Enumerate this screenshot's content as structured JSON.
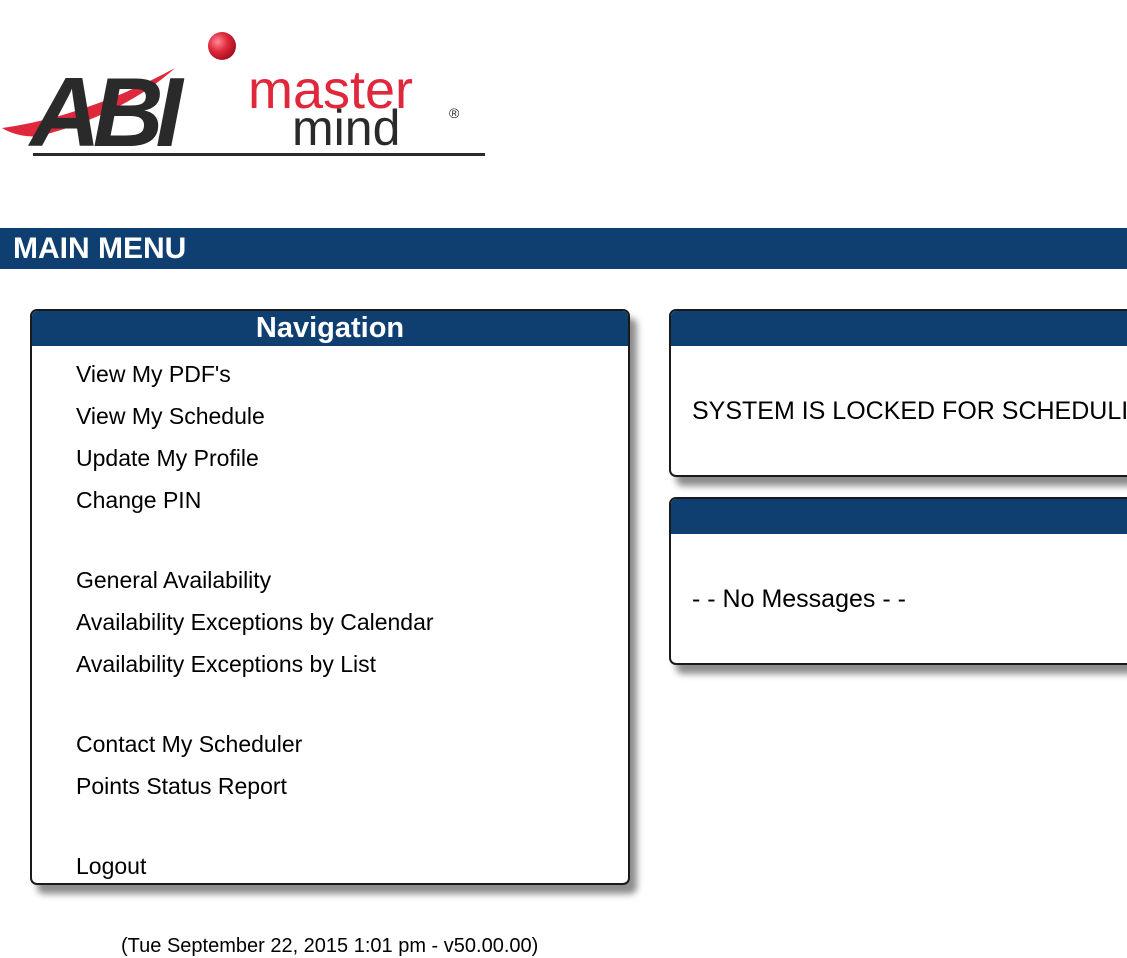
{
  "logo": {
    "brand": "ABI",
    "word1": "master",
    "word2": "mind",
    "registered": "®",
    "colors": {
      "dark": "#2a2a2a",
      "accent": "#e0283c"
    }
  },
  "menu_bar": {
    "title": "MAIN MENU",
    "color": "#0f3f70"
  },
  "navigation": {
    "title": "Navigation",
    "groups": [
      [
        "View My PDF's",
        "View My Schedule",
        "Update My Profile",
        "Change PIN"
      ],
      [
        "General Availability",
        "Availability Exceptions by Calendar",
        "Availability Exceptions by List"
      ],
      [
        "Contact My Scheduler",
        "Points Status Report"
      ],
      [
        "Logout"
      ]
    ]
  },
  "status_panel": {
    "title": "",
    "text": "SYSTEM IS LOCKED FOR SCHEDULING"
  },
  "messages_panel": {
    "title": "",
    "text": "- - No Messages - -"
  },
  "footer": {
    "text": "(Tue September 22, 2015 1:01 pm - v50.00.00)"
  }
}
